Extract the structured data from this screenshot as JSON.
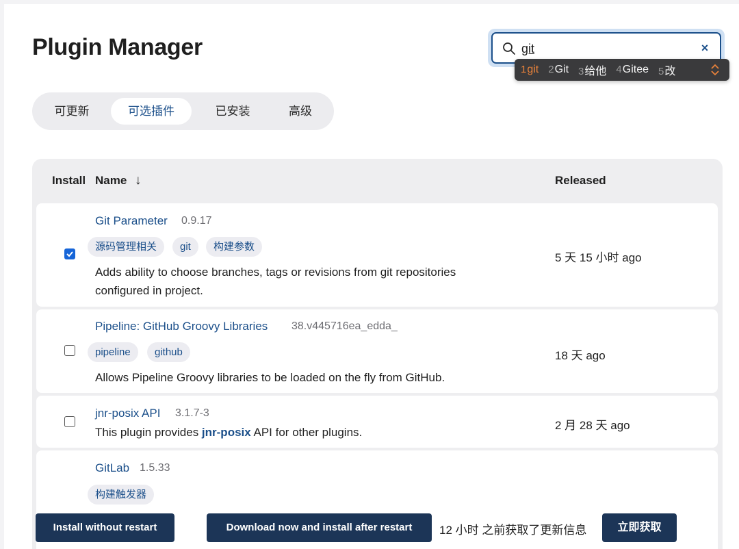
{
  "page": {
    "title": "Plugin Manager"
  },
  "search": {
    "value": "git",
    "clear_icon": "×"
  },
  "ime": {
    "candidates": [
      {
        "num": "1",
        "text": "git"
      },
      {
        "num": "2",
        "text": "Git"
      },
      {
        "num": "3",
        "text": "给他"
      },
      {
        "num": "4",
        "text": "Gitee"
      },
      {
        "num": "5",
        "text": "改"
      }
    ]
  },
  "tabs": [
    {
      "label": "可更新"
    },
    {
      "label": "可选插件"
    },
    {
      "label": "已安装"
    },
    {
      "label": "高级"
    }
  ],
  "table": {
    "headers": {
      "install": "Install",
      "name": "Name",
      "sort_icon": "↓",
      "released": "Released"
    },
    "rows": [
      {
        "name": "Git Parameter",
        "version": "0.9.17",
        "tags": [
          "源码管理相关",
          "git",
          "构建参数"
        ],
        "checked": true,
        "desc_line1": "Adds ability to choose branches, tags or revisions from git repositories",
        "desc_line2": "configured in project.",
        "released": "5 天 15 小时 ago"
      },
      {
        "name": "Pipeline: GitHub Groovy Libraries",
        "version": "38.v445716ea_edda_",
        "tags": [
          "pipeline",
          "github"
        ],
        "checked": false,
        "desc": "Allows Pipeline Groovy libraries to be loaded on the fly from GitHub.",
        "released": "18 天 ago"
      },
      {
        "name": "jnr-posix API",
        "version": "3.1.7-3",
        "checked": false,
        "desc_before": "This plugin provides ",
        "desc_link": "jnr-posix",
        "desc_after": " API for other plugins.",
        "released": "2 月 28 天 ago"
      },
      {
        "name": "GitLab",
        "version": "1.5.33",
        "tags": [
          "构建触发器"
        ]
      }
    ]
  },
  "footer": {
    "install_without_restart": "Install without restart",
    "download_install_after_restart": "Download now and install after restart",
    "update_info": "12 小时 之前获取了更新信息",
    "fetch_now": "立即获取"
  },
  "colors": {
    "accent": "#1b4f8a",
    "button": "#1c3557",
    "checkbox": "#1665d8",
    "ime_active": "#e8823b"
  }
}
